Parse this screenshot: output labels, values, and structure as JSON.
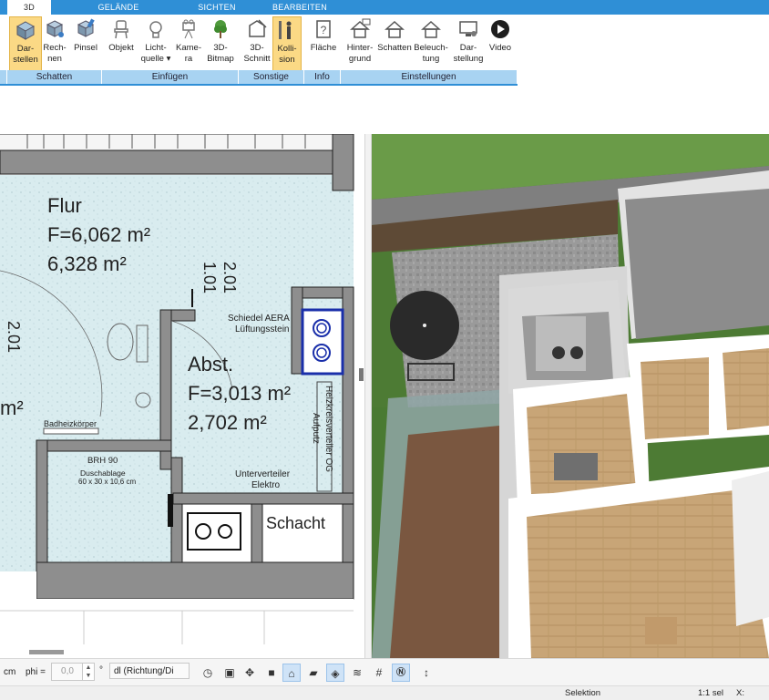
{
  "tabs": [
    {
      "label": "3D",
      "active": true
    },
    {
      "label": "GELÄNDE",
      "active": false
    },
    {
      "label": "SICHTEN",
      "active": false
    },
    {
      "label": "BEARBEITEN",
      "active": false
    }
  ],
  "ribbon": {
    "buttons": [
      {
        "l1": "Dar-",
        "l2": "stellen",
        "icon": "cube-shade-icon",
        "selected": true
      },
      {
        "l1": "Rech-",
        "l2": "nen",
        "icon": "cube-calc-icon",
        "selected": false
      },
      {
        "l1": "Pinsel",
        "l2": "",
        "icon": "brush-icon",
        "selected": false
      },
      {
        "l1": "Objekt",
        "l2": "",
        "icon": "chair-icon",
        "selected": false
      },
      {
        "l1": "Licht-",
        "l2": "quelle ▾",
        "icon": "lightbulb-icon",
        "selected": false
      },
      {
        "l1": "Kame-",
        "l2": "ra",
        "icon": "camera-icon",
        "selected": false
      },
      {
        "l1": "3D-",
        "l2": "Bitmap",
        "icon": "tree-icon",
        "selected": false
      },
      {
        "l1": "3D-",
        "l2": "Schnitt",
        "icon": "section-cut-icon",
        "selected": false
      },
      {
        "l1": "Kolli-",
        "l2": "sion",
        "icon": "collision-person-icon",
        "selected": true
      },
      {
        "l1": "Fläche",
        "l2": "",
        "icon": "area-info-icon",
        "selected": false
      },
      {
        "l1": "Hinter-",
        "l2": "grund",
        "icon": "house-background-icon",
        "selected": false
      },
      {
        "l1": "Schatten",
        "l2": "",
        "icon": "house-shadow-icon",
        "selected": false
      },
      {
        "l1": "Beleuch-",
        "l2": "tung",
        "icon": "house-light-icon",
        "selected": false
      },
      {
        "l1": "Dar-",
        "l2": "stellung",
        "icon": "monitor-settings-icon",
        "selected": false
      },
      {
        "l1": "Video",
        "l2": "",
        "icon": "play-icon",
        "selected": false
      }
    ],
    "groups": [
      "Schatten",
      "Einfügen",
      "Sonstige",
      "Info",
      "Einstellungen"
    ]
  },
  "plan": {
    "rooms": [
      {
        "name": "Flur",
        "area1": "F=6,062 m²",
        "area2": "6,328 m²"
      },
      {
        "name": "Abst.",
        "area1": "F=3,013 m²",
        "area2": "2,702 m²"
      }
    ],
    "dim_a": "1.01",
    "dim_b": "2.01",
    "dim_left": "2.01",
    "partial_area": "m²",
    "labels": {
      "vent": "Schiedel AERA",
      "vent2": "Lüftungsstein",
      "heater": "Badheizkörper",
      "brh": "BRH 90",
      "shelf": "Duschablage",
      "shelf_size": "60 x 30 x 10,6 cm",
      "distributor": "Unterverteiler",
      "distributor2": "Elektro",
      "heating": "Heizkreisverteiler OG",
      "heating2": "Aufputz",
      "shaft": "Schacht"
    }
  },
  "toolbar": {
    "unit": "cm",
    "phi_label": "phi =",
    "phi_value": "0,0",
    "degree": "°",
    "dl_value": "dl (Richtung/Di",
    "icons": [
      "clock-icon",
      "monitor-icon",
      "camera-move-icon",
      "paint-icon",
      "roof-icon",
      "car-icon",
      "layer-icon",
      "stack-icon",
      "grid-icon",
      "north-icon",
      "pin-icon"
    ]
  },
  "status": {
    "mode": "Selektion",
    "scale": "1:1 sel",
    "coord": "X:"
  },
  "colors": {
    "accent": "#2f8fd6",
    "group_bar": "#a8d3f2",
    "selected": "#fbd985",
    "tile": "#d9ecef",
    "wall": "#8e8e8e"
  }
}
